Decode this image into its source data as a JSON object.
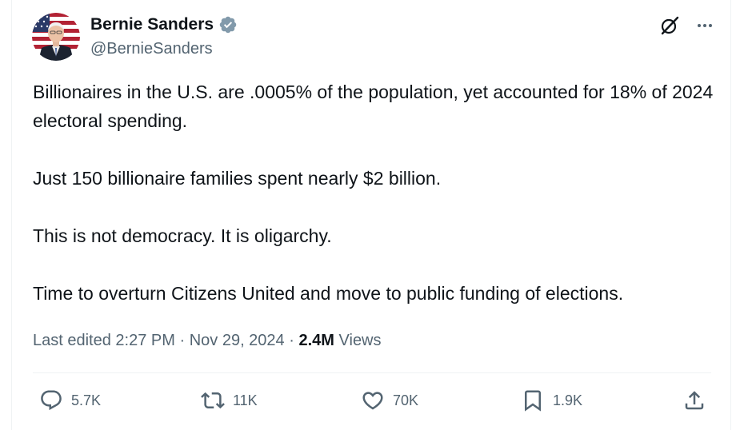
{
  "author": {
    "display_name": "Bernie Sanders",
    "handle": "@BernieSanders",
    "verified": true,
    "verified_color": "#829aab",
    "avatar_icon": "profile-photo"
  },
  "top_actions": {
    "grok_icon": "grok-icon",
    "more_icon": "more-dots-icon"
  },
  "tweet": {
    "paragraphs": [
      "Billionaires in the U.S. are .0005% of the population, yet accounted for 18% of 2024 electoral spending.",
      "Just 150 billionaire families spent nearly $2 billion.",
      "This is not democracy. It is oligarchy.",
      "Time to overturn Citizens United and move to public funding of elections."
    ]
  },
  "meta": {
    "edited_label": "Last edited",
    "time": "2:27 PM",
    "separator": "·",
    "date": "Nov 29, 2024",
    "views_count": "2.4M",
    "views_label": "Views"
  },
  "actions": {
    "replies": "5.7K",
    "reposts": "11K",
    "likes": "70K",
    "bookmarks": "1.9K"
  },
  "colors": {
    "text_primary": "#0f1419",
    "text_secondary": "#536471",
    "divider": "#eff3f4"
  }
}
